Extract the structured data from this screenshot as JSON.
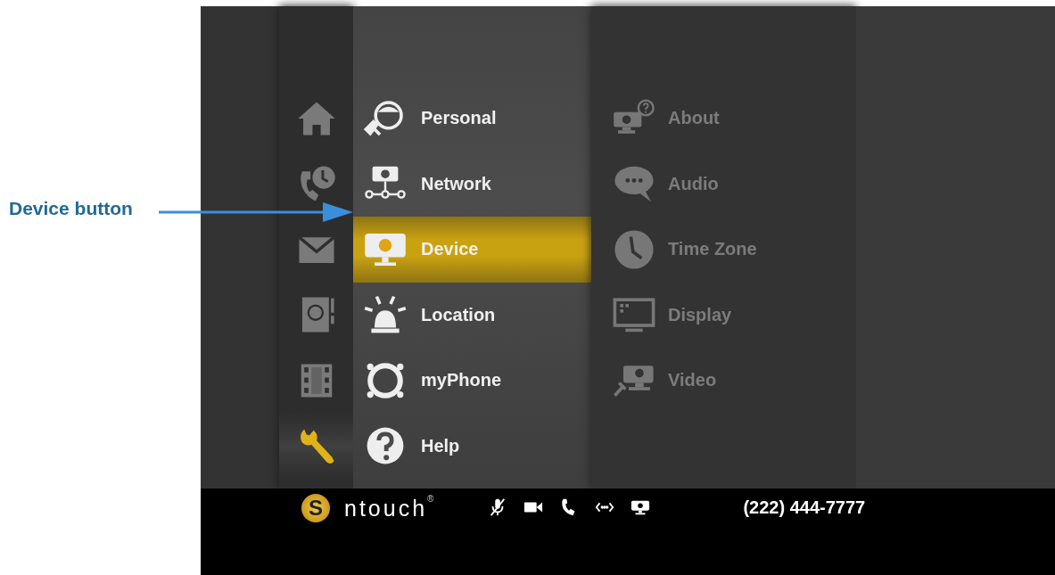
{
  "callout": {
    "label": "Device button"
  },
  "nav_rail": {
    "items": [
      {
        "selected": false
      },
      {
        "selected": false
      },
      {
        "selected": false
      },
      {
        "selected": false
      },
      {
        "selected": false
      },
      {
        "selected": true
      }
    ]
  },
  "menu": {
    "items": [
      {
        "label": "Personal",
        "selected": false
      },
      {
        "label": "Network",
        "selected": false
      },
      {
        "label": "Device",
        "selected": true
      },
      {
        "label": "Location",
        "selected": false
      },
      {
        "label": "myPhone",
        "selected": false
      },
      {
        "label": "Help",
        "selected": false
      }
    ]
  },
  "submenu": {
    "items": [
      {
        "label": "About"
      },
      {
        "label": "Audio"
      },
      {
        "label": "Time Zone"
      },
      {
        "label": "Display"
      },
      {
        "label": "Video"
      }
    ]
  },
  "status_bar": {
    "logo_mark": "S",
    "brand": "ntouch",
    "brand_mark": "®",
    "phone_number": "(222) 444-7777"
  }
}
